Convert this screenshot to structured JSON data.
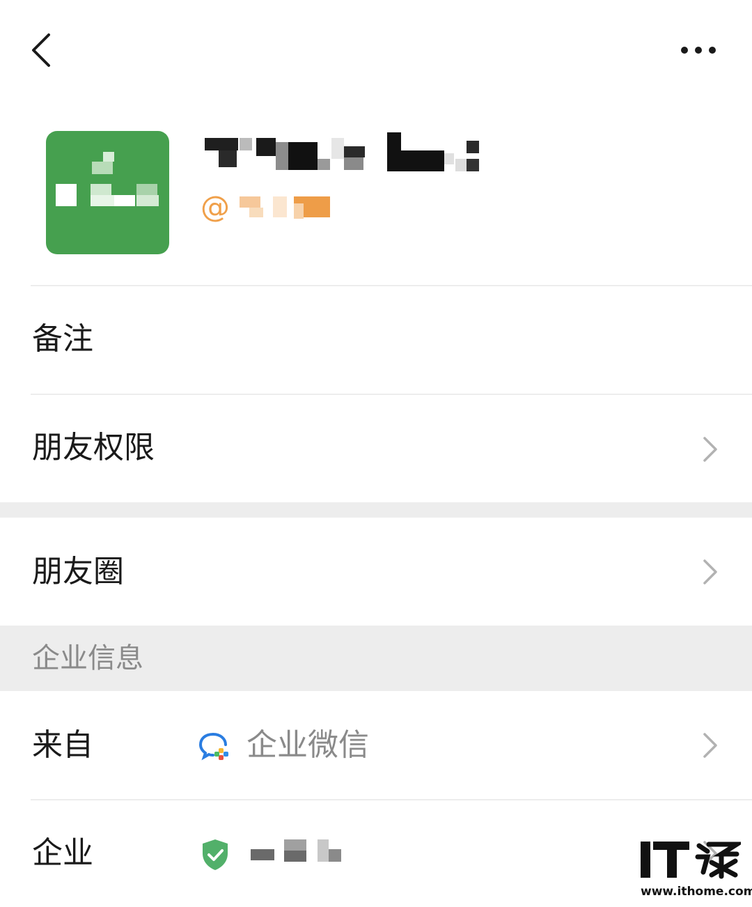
{
  "header": {
    "back_icon": "chevron-left-icon",
    "more_icon": "more-horizontal-icon"
  },
  "profile": {
    "at_symbol": "@"
  },
  "rows": {
    "remark": {
      "label": "备注"
    },
    "permissions": {
      "label": "朋友权限"
    },
    "moments": {
      "label": "朋友圈"
    }
  },
  "enterprise_section": {
    "header": "企业信息",
    "from": {
      "label": "来自",
      "value": "企业微信"
    },
    "company": {
      "label": "企业"
    }
  },
  "watermark": {
    "logo_text": "IT之家",
    "url": "www.ithome.com"
  },
  "colors": {
    "avatar_bg": "#46a04f",
    "handle": "#f0a04a",
    "verified": "#52b06a",
    "chevron": "#b2b2b2",
    "gap": "#ededed"
  }
}
